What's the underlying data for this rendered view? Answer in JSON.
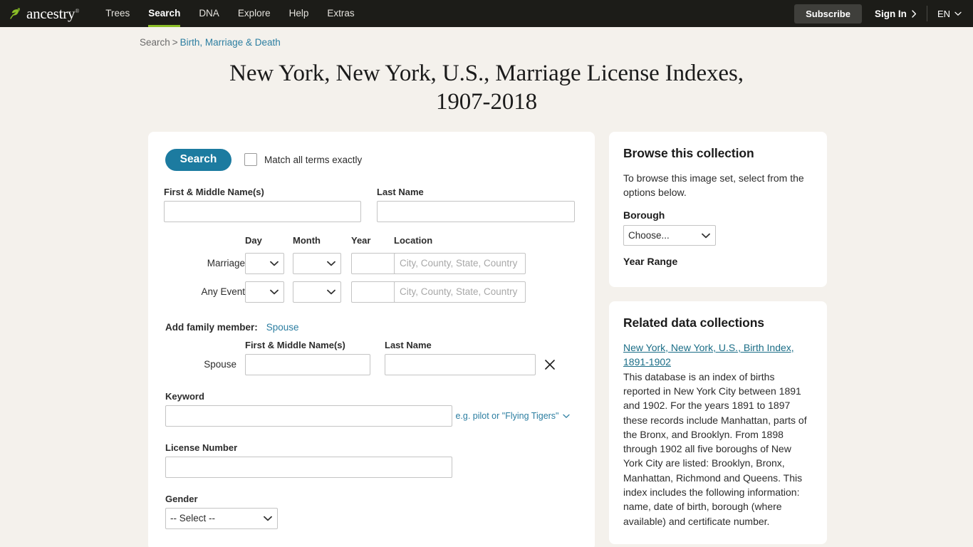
{
  "header": {
    "logo_text": "ancestry",
    "logo_tm": "®",
    "nav": [
      {
        "label": "Trees",
        "active": false
      },
      {
        "label": "Search",
        "active": true
      },
      {
        "label": "DNA",
        "active": false
      },
      {
        "label": "Explore",
        "active": false
      },
      {
        "label": "Help",
        "active": false
      },
      {
        "label": "Extras",
        "active": false
      }
    ],
    "subscribe_label": "Subscribe",
    "signin_label": "Sign In",
    "language_label": "EN"
  },
  "breadcrumb": {
    "root": "Search",
    "separator": ">",
    "current": "Birth, Marriage & Death"
  },
  "page_title": "New York, New York, U.S., Marriage License Indexes, 1907-2018",
  "search_form": {
    "search_button": "Search",
    "match_exactly_label": "Match all terms exactly",
    "first_name_label": "First & Middle Name(s)",
    "first_name_value": "",
    "last_name_label": "Last Name",
    "last_name_value": "",
    "date_headers": {
      "day": "Day",
      "month": "Month",
      "year": "Year",
      "location": "Location"
    },
    "date_rows": [
      {
        "label": "Marriage",
        "day_value": "",
        "month_value": "",
        "year_value": "",
        "location_placeholder": "City, County, State, Country"
      },
      {
        "label": "Any Event",
        "day_value": "",
        "month_value": "",
        "year_value": "",
        "location_placeholder": "City, County, State, Country"
      }
    ],
    "add_family_label": "Add family member:",
    "add_family_link": "Spouse",
    "spouse_headers": {
      "first": "First & Middle Name(s)",
      "last": "Last Name"
    },
    "spouse_row_label": "Spouse",
    "spouse_first_value": "",
    "spouse_last_value": "",
    "remove_spouse_icon": "close-icon",
    "keyword_label": "Keyword",
    "keyword_value": "",
    "keyword_hint": "e.g. pilot or \"Flying Tigers\"",
    "license_label": "License Number",
    "license_value": "",
    "gender_label": "Gender",
    "gender_value": "-- Select --"
  },
  "browse_card": {
    "title": "Browse this collection",
    "intro": "To browse this image set, select from the options below.",
    "borough_label": "Borough",
    "borough_value": "Choose...",
    "year_range_label": "Year Range"
  },
  "related_card": {
    "title": "Related data collections",
    "link_text": "New York, New York, U.S., Birth Index, 1891-1902",
    "description": "This database is an index of births reported in New York City between 1891 and 1902. For the years 1891 to 1897 these records include Manhattan, parts of the Bronx, and Brooklyn. From 1898 through 1902 all five boroughs of New York City are listed: Brooklyn, Bronx, Manhattan, Richmond and Queens. This index includes the following information: name, date of birth, borough (where available) and certificate number."
  },
  "colors": {
    "page_background": "#f4f1ec",
    "header_background": "#1c1c18",
    "accent_green": "#8cbf27",
    "accent_teal": "#1c7ba0",
    "link_blue": "#2c7ea1"
  }
}
